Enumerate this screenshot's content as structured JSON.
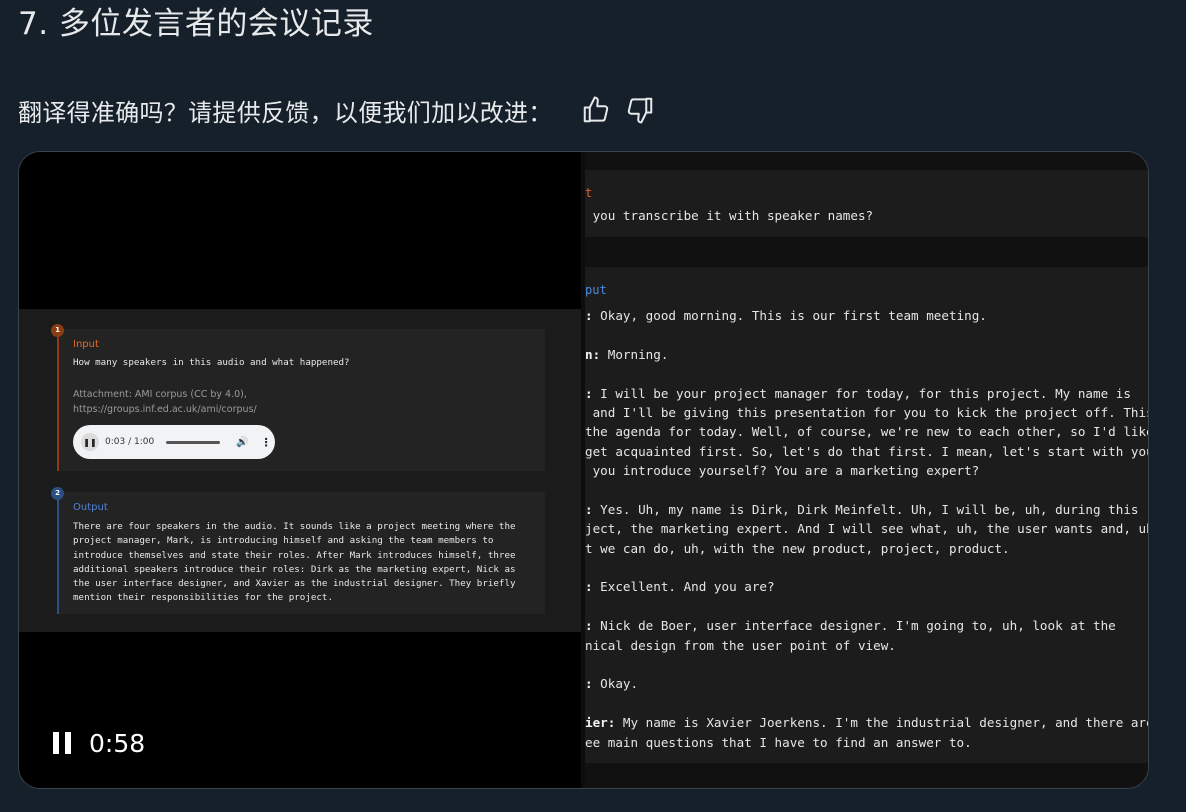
{
  "section": {
    "title": "7. 多位发言者的会议记录"
  },
  "feedback": {
    "prompt": "翻译得准确吗？请提供反馈，以便我们加以改进：",
    "up_icon": "thumbs-up-icon",
    "down_icon": "thumbs-down-icon"
  },
  "video": {
    "time": "0:58",
    "left": {
      "input": {
        "badge": "1",
        "label": "Input",
        "question": "How many speakers in this audio and what happened?",
        "attachment": "Attachment: AMI corpus (CC by 4.0),\nhttps://groups.inf.ed.ac.uk/ami/corpus/",
        "audio_time": "0:03 / 1:00"
      },
      "output": {
        "badge": "2",
        "label": "Output",
        "text": "There are four speakers in the audio. It sounds like a project meeting where the\nproject manager, Mark, is introducing himself and asking the team members to\nintroduce themselves and state their roles. After Mark introduces himself, three\nadditional speakers introduce their roles: Dirk as the marketing expert, Nick as\nthe user interface designer, and Xavier as the industrial designer. They briefly\nmention their responsibilities for the project."
      }
    },
    "right": {
      "input_label": "t",
      "input_text": " you transcribe it with speaker names?",
      "output_label": "put",
      "lines": [
        {
          "s": ":",
          "t": " Okay, good morning. This is our first team meeting."
        },
        {
          "s": "",
          "t": ""
        },
        {
          "s": "n:",
          "t": " Morning."
        },
        {
          "s": "",
          "t": ""
        },
        {
          "s": ":",
          "t": " I will be your project manager for today, for this project. My name is"
        },
        {
          "s": "",
          "t": " and I'll be giving this presentation for you to kick the project off. This"
        },
        {
          "s": "",
          "t": "the agenda for today. Well, of course, we're new to each other, so I'd like"
        },
        {
          "s": "",
          "t": "get acquainted first. So, let's do that first. I mean, let's start with you"
        },
        {
          "s": "",
          "t": " you introduce yourself? You are a marketing expert?"
        },
        {
          "s": "",
          "t": ""
        },
        {
          "s": ":",
          "t": " Yes. Uh, my name is Dirk, Dirk Meinfelt. Uh, I will be, uh, during this"
        },
        {
          "s": "",
          "t": "ject, the marketing expert. And I will see what, uh, the user wants and, uh"
        },
        {
          "s": "",
          "t": "t we can do, uh, with the new product, project, product."
        },
        {
          "s": "",
          "t": ""
        },
        {
          "s": ":",
          "t": " Excellent. And you are?"
        },
        {
          "s": "",
          "t": ""
        },
        {
          "s": ":",
          "t": " Nick de Boer, user interface designer. I'm going to, uh, look at the"
        },
        {
          "s": "",
          "t": "nical design from the user point of view."
        },
        {
          "s": "",
          "t": ""
        },
        {
          "s": ":",
          "t": " Okay."
        },
        {
          "s": "",
          "t": ""
        },
        {
          "s": "ier:",
          "t": " My name is Xavier Joerkens. I'm the industrial designer, and there are"
        },
        {
          "s": "",
          "t": "ee main questions that I have to find an answer to."
        }
      ]
    }
  }
}
